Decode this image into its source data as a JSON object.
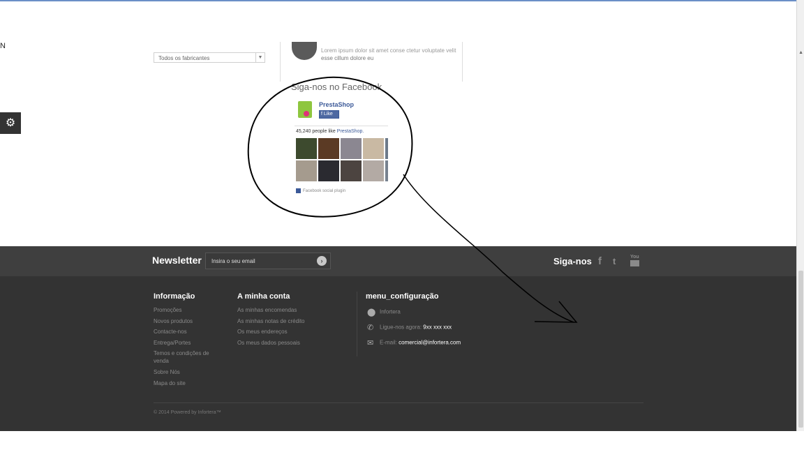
{
  "filter": {
    "manufacturer_select": "Todos os fabricantes"
  },
  "promo": {
    "line1": "Lorem ipsum dolor sit amet conse ctetur voluptate velit",
    "line2": "esse cillum dolore eu"
  },
  "facebook": {
    "title": "Siga-nos no Facebook",
    "page_name": "PrestaShop",
    "like_button": "Like",
    "likes_prefix": "45,240 people like",
    "likes_page_link": "PrestaShop.",
    "plugin_label": "Facebook social plugin"
  },
  "newsletter": {
    "label": "Newsletter",
    "placeholder": "Insira o seu email"
  },
  "social": {
    "label": "Siga-nos",
    "icons": [
      "facebook-icon",
      "twitter-icon",
      "youtube-icon"
    ],
    "youtube_text": "You"
  },
  "footer": {
    "info": {
      "title": "Informação",
      "items": [
        "Promoções",
        "Novos produtos",
        "Contacte-nos",
        "Entrega/Portes",
        "Temos e condições de venda",
        "Sobre Nós",
        "Mapa do site"
      ]
    },
    "account": {
      "title": "A minha conta",
      "items": [
        "As minhas encomendas",
        "As minhas notas de crédito",
        "Os meus endereços",
        "Os meus dados pessoais"
      ]
    },
    "store": {
      "title": "menu_configuração",
      "name": "Infortera",
      "phone_label": "Ligue-nos agora:",
      "phone": "9xx xxx xxx",
      "email_label": "E-mail:",
      "email": "comercial@infortera.com"
    },
    "copyright": "© 2014 Powered by Infortera™"
  },
  "colors": {
    "footer_bar": "#3f3f3f",
    "footer_main": "#333333",
    "facebook_blue": "#3b5998"
  }
}
